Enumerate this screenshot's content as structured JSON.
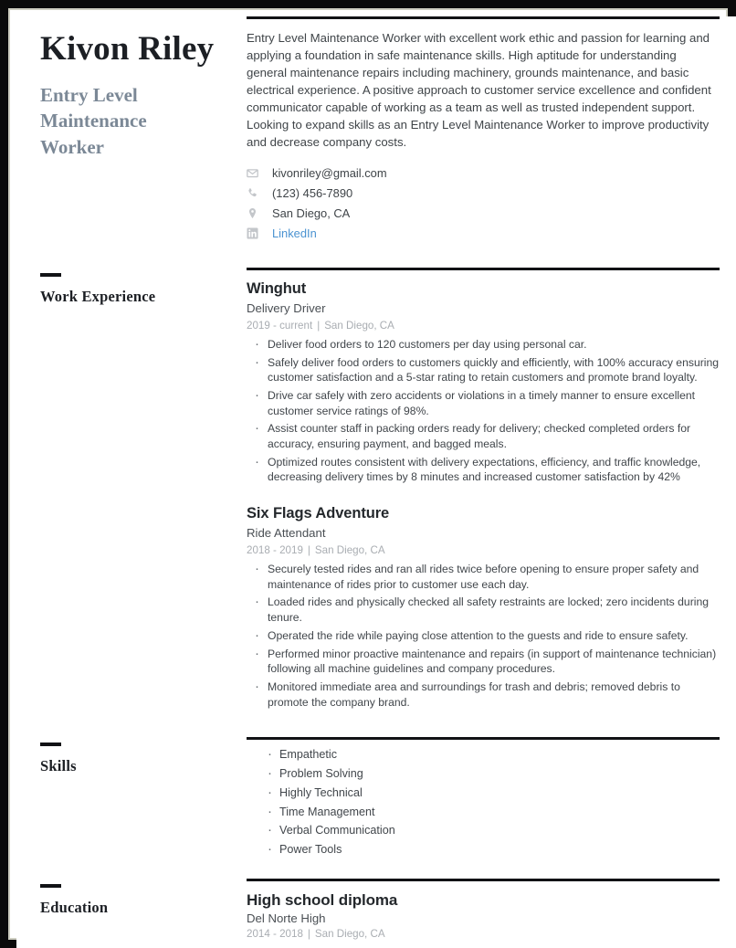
{
  "header": {
    "name": "Kivon Riley",
    "job_title": "Entry Level Maintenance Worker",
    "summary": "Entry Level Maintenance Worker with excellent work ethic and passion for learning and applying a foundation in safe maintenance skills. High aptitude for understanding general maintenance repairs including machinery, grounds maintenance, and basic electrical experience. A positive approach to customer service excellence and confident communicator capable of working as a team as well as trusted independent support. Looking to expand skills as an Entry Level Maintenance Worker to improve productivity and decrease company costs."
  },
  "contact": [
    {
      "icon": "envelope-icon",
      "text": "kivonriley@gmail.com",
      "link": false
    },
    {
      "icon": "phone-icon",
      "text": "(123) 456-7890",
      "link": false
    },
    {
      "icon": "location-pin-icon",
      "text": "San Diego, CA",
      "link": false
    },
    {
      "icon": "linkedin-icon",
      "text": "LinkedIn",
      "link": true
    }
  ],
  "sections": {
    "work_experience": {
      "label": "Work Experience",
      "entries": [
        {
          "company": "Winghut",
          "role": "Delivery Driver",
          "dates": "2019 - current",
          "separator": "|",
          "location": "San Diego, CA",
          "bullets": [
            "Deliver food orders to 120 customers per day using personal car.",
            "Safely deliver food orders to customers quickly and efficiently, with 100% accuracy ensuring customer satisfaction and a 5-star rating to retain customers and promote brand loyalty.",
            "Drive car safely with zero accidents or violations in a timely manner to ensure excellent customer service ratings of 98%.",
            "Assist counter staff in packing orders ready for delivery; checked completed orders for accuracy, ensuring payment, and bagged meals.",
            "Optimized routes consistent with delivery expectations, efficiency, and traffic knowledge, decreasing delivery times by 8 minutes and increased customer satisfaction by 42%"
          ]
        },
        {
          "company": "Six Flags Adventure",
          "role": "Ride Attendant",
          "dates": "2018 - 2019",
          "separator": "|",
          "location": "San Diego, CA",
          "bullets": [
            "Securely tested rides and ran all rides twice before opening to ensure proper safety and maintenance of rides prior to customer use each day.",
            "Loaded rides and physically checked all safety restraints are locked; zero incidents during tenure.",
            "Operated the ride while paying close attention to the guests and ride to ensure safety.",
            "Performed minor proactive maintenance and repairs (in support of maintenance technician) following all machine guidelines and company procedures.",
            "Monitored immediate area and surroundings for trash and debris; removed debris to promote the company brand."
          ]
        }
      ]
    },
    "skills": {
      "label": "Skills",
      "items": [
        "Empathetic",
        "Problem Solving",
        "Highly Technical",
        "Time Management",
        "Verbal Communication",
        "Power Tools"
      ]
    },
    "education": {
      "label": "Education",
      "entries": [
        {
          "degree": "High school diploma",
          "school": "Del Norte High",
          "dates": "2014 - 2018",
          "separator": "|",
          "location": "San Diego, CA"
        }
      ]
    }
  },
  "colors": {
    "accent_title": "#7b8896",
    "name_text": "#1c1f24",
    "link": "#4b93d1",
    "rule": "#111215",
    "meta_text": "#a9adb2",
    "frame": "#0b0b0b"
  }
}
